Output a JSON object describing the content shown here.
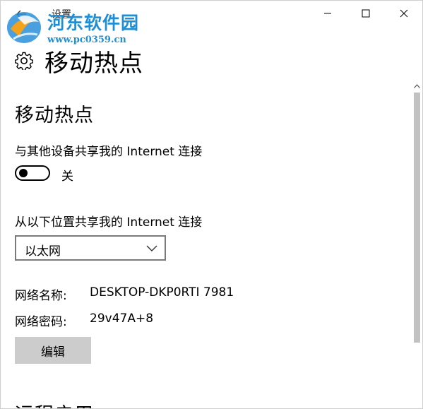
{
  "window": {
    "title": "设置",
    "back_icon": "back-arrow-icon",
    "controls": {
      "minimize_icon": "minimize-icon",
      "maximize_icon": "maximize-icon",
      "close_icon": "close-icon"
    }
  },
  "watermark": {
    "site_name": "河东软件园",
    "url": "www.pc0359.cn",
    "color": "#1e8fd6"
  },
  "page": {
    "icon": "gear-icon",
    "title": "移动热点"
  },
  "hotspot": {
    "section_title": "移动热点",
    "share_label": "与其他设备共享我的 Internet 连接",
    "toggle_state_label": "关",
    "toggle_on": false,
    "share_from_label": "从以下位置共享我的 Internet 连接",
    "share_from_value": "以太网",
    "network_name_label": "网络名称:",
    "network_name_value": "DESKTOP-DKP0RTI 7981",
    "network_password_label": "网络密码:",
    "network_password_value": "29v47A+8",
    "edit_button_label": "编辑"
  },
  "next_section": {
    "title": "远程启用"
  },
  "colors": {
    "button_bg": "#cccccc",
    "scroll_thumb": "#c2c2c2"
  }
}
